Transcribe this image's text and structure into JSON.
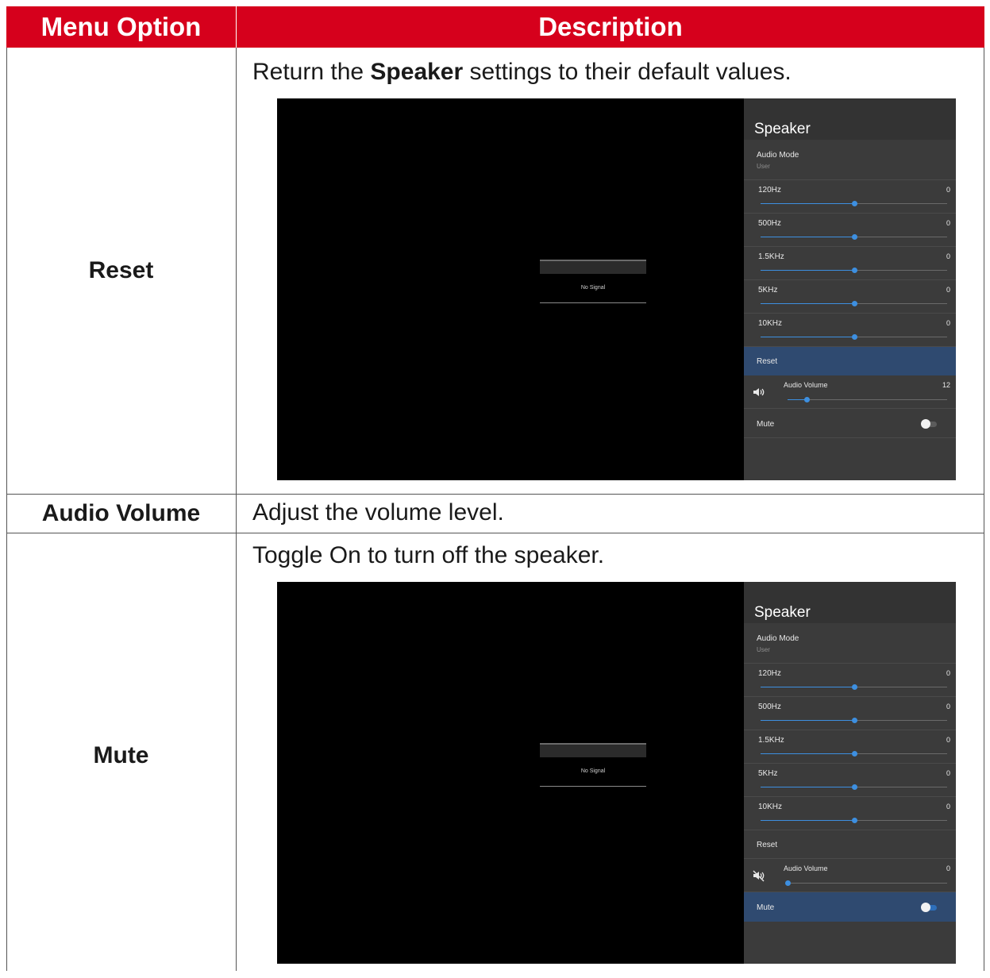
{
  "table": {
    "header": {
      "menu_option": "Menu Option",
      "description": "Description"
    },
    "rows": [
      {
        "option": "Reset",
        "desc_before": "Return the ",
        "desc_bold": "Speaker",
        "desc_after": " settings to their default values."
      },
      {
        "option": "Audio Volume",
        "desc": "Adjust the volume level."
      },
      {
        "option": "Mute",
        "desc": "Toggle On to turn off the speaker."
      }
    ]
  },
  "screens": [
    {
      "no_signal": "No Signal",
      "panel": {
        "title": "Speaker",
        "audio_mode": {
          "label": "Audio Mode",
          "value": "User"
        },
        "eq": [
          {
            "label": "120Hz",
            "value": "0",
            "level": 0.5
          },
          {
            "label": "500Hz",
            "value": "0",
            "level": 0.5
          },
          {
            "label": "1.5KHz",
            "value": "0",
            "level": 0.5
          },
          {
            "label": "5KHz",
            "value": "0",
            "level": 0.5
          },
          {
            "label": "10KHz",
            "value": "0",
            "level": 0.5
          }
        ],
        "reset": "Reset",
        "volume": {
          "label": "Audio Volume",
          "value": "12",
          "level": 0.12
        },
        "mute": {
          "label": "Mute",
          "on": false
        },
        "selected": "reset"
      }
    },
    {
      "no_signal": "No Signal",
      "panel": {
        "title": "Speaker",
        "audio_mode": {
          "label": "Audio Mode",
          "value": "User"
        },
        "eq": [
          {
            "label": "120Hz",
            "value": "0",
            "level": 0.5
          },
          {
            "label": "500Hz",
            "value": "0",
            "level": 0.5
          },
          {
            "label": "1.5KHz",
            "value": "0",
            "level": 0.5
          },
          {
            "label": "5KHz",
            "value": "0",
            "level": 0.5
          },
          {
            "label": "10KHz",
            "value": "0",
            "level": 0.5
          }
        ],
        "reset": "Reset",
        "volume": {
          "label": "Audio Volume",
          "value": "0",
          "level": 0
        },
        "mute": {
          "label": "Mute",
          "on": true
        },
        "selected": "mute"
      }
    }
  ],
  "colors": {
    "header_red": "#d6001c",
    "selected_row": "#2f4a70",
    "slider_blue": "#3d8fe0"
  }
}
